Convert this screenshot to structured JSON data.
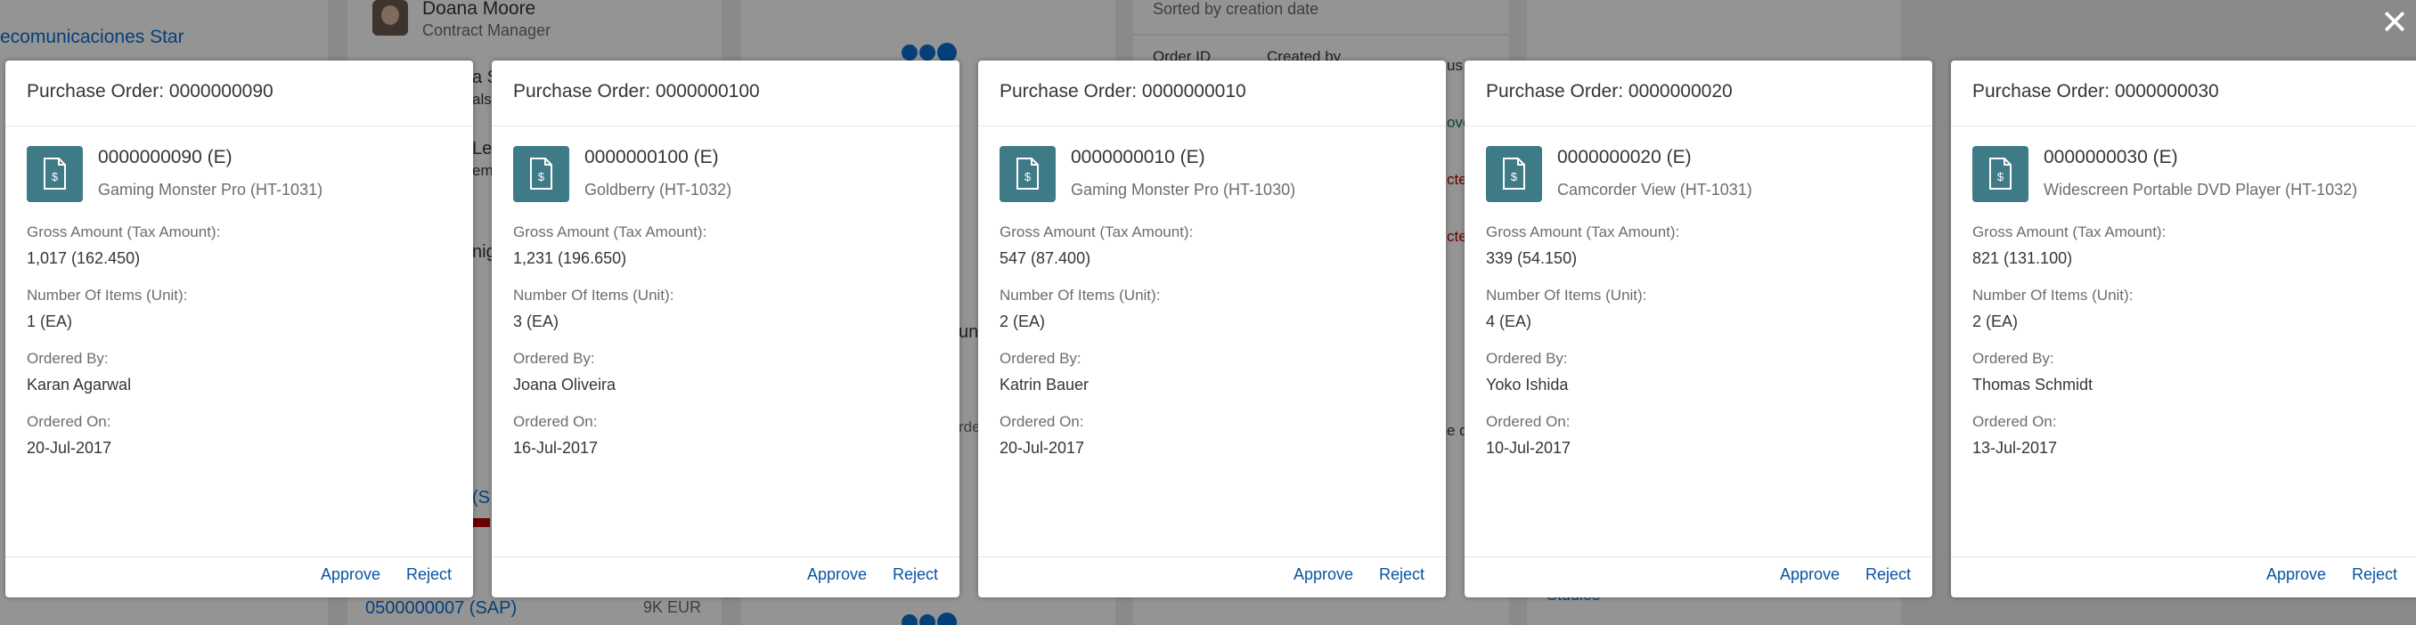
{
  "background": {
    "customer_name": "ecomunicaciones Star",
    "contact_name": "Doana Moore",
    "contact_role": "Contract Manager",
    "sort_label": "Sorted by creation date",
    "col_order_id": "Order ID",
    "col_created_by": "Created by",
    "frag_a": "a S",
    "frag_b": "als",
    "frag_c": "Le",
    "frag_d": "em",
    "frag_e": "nigh",
    "frag_f": "(S",
    "frag_g": "Studios",
    "frag_h": "unit",
    "frag_i": "us",
    "frag_j": "ove",
    "frag_k": "cte",
    "frag_l": "cte",
    "frag_m": "e q",
    "frag_n": "rde",
    "bottom_id": "0500000007 (SAP)",
    "bottom_amount": "9K EUR"
  },
  "dialog": {
    "close_icon": "close-icon",
    "next_icon": "chevron-right-icon"
  },
  "cards": [
    {
      "title": "Purchase Order: 0000000090",
      "id": "0000000090 (E)",
      "product": "Gaming Monster Pro (HT-1031)",
      "gross_label": "Gross Amount (Tax Amount):",
      "gross_value": "1,017 (162.450)",
      "items_label": "Number Of Items (Unit):",
      "items_value": "1 (EA)",
      "ordered_by_label": "Ordered By:",
      "ordered_by_value": "Karan Agarwal",
      "ordered_on_label": "Ordered On:",
      "ordered_on_value": "20-Jul-2017",
      "approve": "Approve",
      "reject": "Reject"
    },
    {
      "title": "Purchase Order: 0000000100",
      "id": "0000000100 (E)",
      "product": "Goldberry (HT-1032)",
      "gross_label": "Gross Amount (Tax Amount):",
      "gross_value": "1,231 (196.650)",
      "items_label": "Number Of Items (Unit):",
      "items_value": "3 (EA)",
      "ordered_by_label": "Ordered By:",
      "ordered_by_value": "Joana Oliveira",
      "ordered_on_label": "Ordered On:",
      "ordered_on_value": "16-Jul-2017",
      "approve": "Approve",
      "reject": "Reject"
    },
    {
      "title": "Purchase Order: 0000000010",
      "id": "0000000010 (E)",
      "product": "Gaming Monster Pro (HT-1030)",
      "gross_label": "Gross Amount (Tax Amount):",
      "gross_value": "547 (87.400)",
      "items_label": "Number Of Items (Unit):",
      "items_value": "2 (EA)",
      "ordered_by_label": "Ordered By:",
      "ordered_by_value": "Katrin Bauer",
      "ordered_on_label": "Ordered On:",
      "ordered_on_value": "20-Jul-2017",
      "approve": "Approve",
      "reject": "Reject"
    },
    {
      "title": "Purchase Order: 0000000020",
      "id": "0000000020 (E)",
      "product": "Camcorder View (HT-1031)",
      "gross_label": "Gross Amount (Tax Amount):",
      "gross_value": "339 (54.150)",
      "items_label": "Number Of Items (Unit):",
      "items_value": "4 (EA)",
      "ordered_by_label": "Ordered By:",
      "ordered_by_value": "Yoko Ishida",
      "ordered_on_label": "Ordered On:",
      "ordered_on_value": "10-Jul-2017",
      "approve": "Approve",
      "reject": "Reject"
    },
    {
      "title": "Purchase Order: 0000000030",
      "id": "0000000030 (E)",
      "product": "Widescreen Portable DVD Player (HT-1032)",
      "gross_label": "Gross Amount (Tax Amount):",
      "gross_value": "821 (131.100)",
      "items_label": "Number Of Items (Unit):",
      "items_value": "2 (EA)",
      "ordered_by_label": "Ordered By:",
      "ordered_by_value": "Thomas Schmidt",
      "ordered_on_label": "Ordered On:",
      "ordered_on_value": "13-Jul-2017",
      "approve": "Approve",
      "reject": "Reject"
    }
  ]
}
